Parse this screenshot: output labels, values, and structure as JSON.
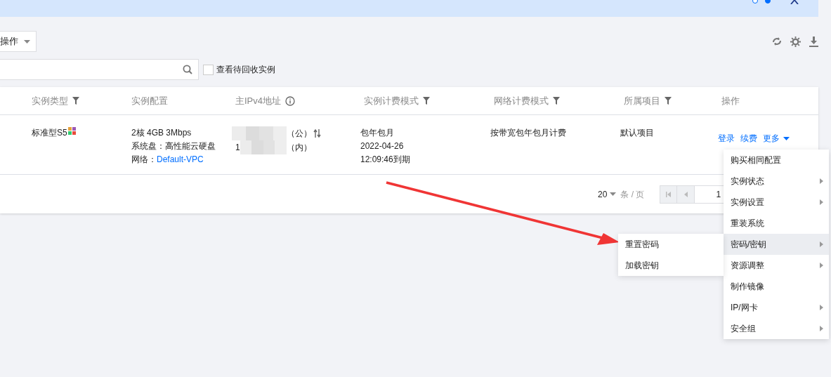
{
  "banner": {
    "dots": [
      {
        "selected": false
      },
      {
        "selected": true
      }
    ]
  },
  "toolbar": {
    "action_button": "操作"
  },
  "filter": {
    "checkbox": {
      "label": "查看待回收实例",
      "checked": false
    }
  },
  "table": {
    "columns": [
      {
        "label": "实例类型",
        "filter": true,
        "info": false
      },
      {
        "label": "实例配置",
        "filter": false,
        "info": false
      },
      {
        "label": "主IPv4地址",
        "filter": false,
        "info": true
      },
      {
        "label": "实例计费模式",
        "filter": true,
        "info": false
      },
      {
        "label": "网络计费模式",
        "filter": true,
        "info": false
      },
      {
        "label": "所属项目",
        "filter": true,
        "info": false
      },
      {
        "label": "操作",
        "filter": false,
        "info": false
      }
    ],
    "rows": [
      {
        "type": "标准型S5",
        "config": [
          "2核 4GB 3Mbps",
          "系统盘：高性能云硬盘"
        ],
        "network_label": "网络：",
        "network_link": "Default-VPC",
        "ip_public": "（公）",
        "ip_private_prefix": "1",
        "ip_private": "（内）",
        "billing": [
          "包年包月",
          "2022-04-26",
          "12:09:46到期"
        ],
        "net_billing": "按带宽包年包月计费",
        "project": "默认项目",
        "actions": [
          "登录",
          "续费"
        ],
        "more": "更多"
      }
    ]
  },
  "pagination": {
    "page_size": "20",
    "unit": "条 / 页",
    "page": "1"
  },
  "more_menu": {
    "items": [
      {
        "label": "购买相同配置",
        "has_submenu": false,
        "highlighted": false
      },
      {
        "label": "实例状态",
        "has_submenu": true,
        "highlighted": false
      },
      {
        "label": "实例设置",
        "has_submenu": true,
        "highlighted": false
      },
      {
        "label": "重装系统",
        "has_submenu": false,
        "highlighted": false
      },
      {
        "label": "密码/密钥",
        "has_submenu": true,
        "highlighted": true
      },
      {
        "label": "资源调整",
        "has_submenu": true,
        "highlighted": false
      },
      {
        "label": "制作镜像",
        "has_submenu": false,
        "highlighted": false
      },
      {
        "label": "IP/网卡",
        "has_submenu": true,
        "highlighted": false
      },
      {
        "label": "安全组",
        "has_submenu": true,
        "highlighted": false
      }
    ],
    "submenu": [
      "重置密码",
      "加载密钥"
    ]
  }
}
